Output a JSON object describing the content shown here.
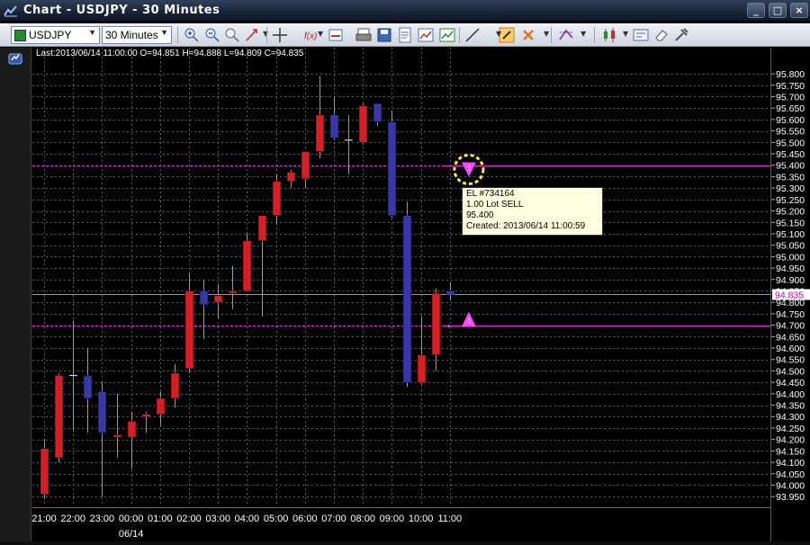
{
  "window": {
    "title": "Chart - USDJPY - 30 Minutes",
    "buttons": {
      "minimize": "_",
      "restore": "□",
      "close": "×"
    }
  },
  "toolbar": {
    "symbol": "USDJPY",
    "timeframe": "30 Minutes",
    "icons": [
      "zoom-in-icon",
      "zoom-out-icon",
      "zoom-reset-icon",
      "arrow-tool-icon",
      "crosshair-icon",
      "indicator-fx-icon",
      "period-icon",
      "print-icon",
      "save-icon",
      "template-icon",
      "chart-image-icon",
      "chart-export-icon",
      "trendline-icon",
      "link-icon",
      "delete-objects-icon",
      "fibonacci-icon",
      "candlestick-icon",
      "properties-icon",
      "eraser-icon",
      "settings-icon"
    ]
  },
  "info": {
    "text": "Last:2013/06/14 11:00:00 O=94.851 H=94.888 L=94.809 C=94.835"
  },
  "order_tooltip": {
    "line1": "EL #734164",
    "line2": "1.00 Lot SELL",
    "line3": "95.400",
    "line4": "Created: 2013/06/14 11:00:59"
  },
  "current_price_label": "94.835",
  "colors": {
    "bull": "#d71e24",
    "bear": "#3838a8",
    "grid": "#5a5a5a",
    "order_line": "#e030e0",
    "price_line": "#b080d8",
    "marker": "#ff44ff",
    "highlight": "#ffee22"
  },
  "chart_data": {
    "type": "candlestick",
    "symbol": "USDJPY",
    "timeframe": "30 Minutes",
    "y_ticks": [
      "95.800",
      "95.750",
      "95.700",
      "95.650",
      "95.600",
      "95.550",
      "95.500",
      "95.450",
      "95.400",
      "95.350",
      "95.300",
      "95.250",
      "95.200",
      "95.150",
      "95.100",
      "95.050",
      "95.000",
      "94.950",
      "94.900",
      "94.850",
      "94.800",
      "94.750",
      "94.700",
      "94.650",
      "94.600",
      "94.550",
      "94.500",
      "94.450",
      "94.400",
      "94.350",
      "94.300",
      "94.250",
      "94.200",
      "94.150",
      "94.100",
      "94.050",
      "94.000",
      "93.950"
    ],
    "ylim": [
      93.935,
      95.82
    ],
    "x_labels": [
      {
        "label": "21:00",
        "bar": 0
      },
      {
        "label": "22:00",
        "bar": 2
      },
      {
        "label": "23:00",
        "bar": 4
      },
      {
        "label": "00:00",
        "bar": 6
      },
      {
        "label": "01:00",
        "bar": 8
      },
      {
        "label": "02:00",
        "bar": 10
      },
      {
        "label": "03:00",
        "bar": 12
      },
      {
        "label": "04:00",
        "bar": 14
      },
      {
        "label": "05:00",
        "bar": 16
      },
      {
        "label": "06:00",
        "bar": 18
      },
      {
        "label": "07:00",
        "bar": 20
      },
      {
        "label": "08:00",
        "bar": 22
      },
      {
        "label": "09:00",
        "bar": 24
      },
      {
        "label": "10:00",
        "bar": 26
      },
      {
        "label": "11:00",
        "bar": 28
      }
    ],
    "date_label": {
      "label": "06/14",
      "bar": 6
    },
    "candles": [
      {
        "t": "21:00",
        "o": 93.96,
        "h": 94.2,
        "l": 93.94,
        "c": 94.16
      },
      {
        "t": "21:30",
        "o": 94.12,
        "h": 94.49,
        "l": 94.1,
        "c": 94.48
      },
      {
        "t": "22:00",
        "o": 94.48,
        "h": 94.72,
        "l": 94.24,
        "c": 94.48
      },
      {
        "t": "22:30",
        "o": 94.48,
        "h": 94.6,
        "l": 94.23,
        "c": 94.38
      },
      {
        "t": "23:00",
        "o": 94.41,
        "h": 94.45,
        "l": 93.95,
        "c": 94.23
      },
      {
        "t": "23:30",
        "o": 94.21,
        "h": 94.4,
        "l": 94.12,
        "c": 94.22
      },
      {
        "t": "00:00",
        "o": 94.21,
        "h": 94.32,
        "l": 94.07,
        "c": 94.28
      },
      {
        "t": "00:30",
        "o": 94.3,
        "h": 94.32,
        "l": 94.23,
        "c": 94.31
      },
      {
        "t": "01:00",
        "o": 94.31,
        "h": 94.41,
        "l": 94.26,
        "c": 94.38
      },
      {
        "t": "01:30",
        "o": 94.38,
        "h": 94.53,
        "l": 94.34,
        "c": 94.49
      },
      {
        "t": "02:00",
        "o": 94.51,
        "h": 94.93,
        "l": 94.49,
        "c": 94.85
      },
      {
        "t": "02:30",
        "o": 94.85,
        "h": 94.9,
        "l": 94.64,
        "c": 94.79
      },
      {
        "t": "03:00",
        "o": 94.8,
        "h": 94.88,
        "l": 94.73,
        "c": 94.83
      },
      {
        "t": "03:30",
        "o": 94.84,
        "h": 94.96,
        "l": 94.77,
        "c": 94.85
      },
      {
        "t": "04:00",
        "o": 94.85,
        "h": 95.1,
        "l": 94.85,
        "c": 95.07
      },
      {
        "t": "04:30",
        "o": 95.07,
        "h": 95.18,
        "l": 94.74,
        "c": 95.18
      },
      {
        "t": "05:00",
        "o": 95.18,
        "h": 95.36,
        "l": 95.14,
        "c": 95.33
      },
      {
        "t": "05:30",
        "o": 95.33,
        "h": 95.38,
        "l": 95.3,
        "c": 95.37
      },
      {
        "t": "06:00",
        "o": 95.34,
        "h": 95.46,
        "l": 95.3,
        "c": 95.46
      },
      {
        "t": "06:30",
        "o": 95.46,
        "h": 95.79,
        "l": 95.43,
        "c": 95.62
      },
      {
        "t": "07:00",
        "o": 95.62,
        "h": 95.7,
        "l": 95.51,
        "c": 95.52
      },
      {
        "t": "07:30",
        "o": 95.51,
        "h": 95.62,
        "l": 95.36,
        "c": 95.51
      },
      {
        "t": "08:00",
        "o": 95.5,
        "h": 95.67,
        "l": 95.49,
        "c": 95.66
      },
      {
        "t": "08:30",
        "o": 95.67,
        "h": 95.67,
        "l": 95.57,
        "c": 95.59
      },
      {
        "t": "09:00",
        "o": 95.59,
        "h": 95.64,
        "l": 95.17,
        "c": 95.18
      },
      {
        "t": "09:30",
        "o": 95.18,
        "h": 95.24,
        "l": 94.43,
        "c": 94.45
      },
      {
        "t": "10:00",
        "o": 94.45,
        "h": 94.74,
        "l": 94.44,
        "c": 94.57
      },
      {
        "t": "10:30",
        "o": 94.57,
        "h": 94.86,
        "l": 94.5,
        "c": 94.84
      },
      {
        "t": "11:00",
        "o": 94.851,
        "h": 94.888,
        "l": 94.809,
        "c": 94.835
      }
    ],
    "order_line_price": 95.4,
    "entry_line_price": 94.7,
    "current_price": 94.835
  }
}
